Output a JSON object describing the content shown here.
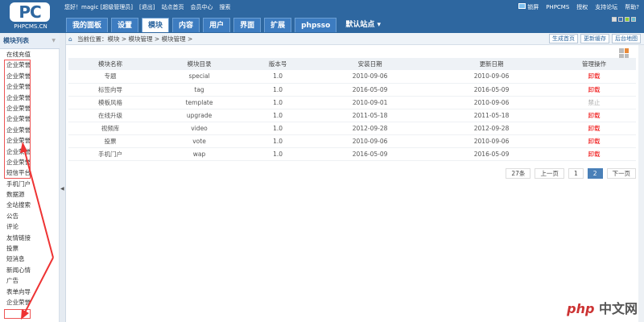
{
  "logo": {
    "mark": "PC",
    "sub": "PHPCMS.CN"
  },
  "userbar": [
    "您好！magic [超级管理员]",
    "[退出]",
    "站点首页",
    "会员中心",
    "搜索"
  ],
  "rightlinks": [
    "锁屏",
    "PHPCMS",
    "授权",
    "支持论坛",
    "帮助?"
  ],
  "tabs": [
    "我的面板",
    "设置",
    "模块",
    "内容",
    "用户",
    "界面",
    "扩展",
    "phpsso",
    "默认站点 ▾"
  ],
  "sidebar": {
    "title": "模块列表",
    "items": [
      "在线充值",
      "企业荣誉",
      "企业荣誉",
      "企业荣誉",
      "企业荣誉",
      "企业荣誉",
      "企业荣誉",
      "企业荣誉",
      "企业荣誉",
      "企业荣誉",
      "企业荣誉",
      "短信平台",
      "手机门户",
      "数据源",
      "全站搜索",
      "公告",
      "评论",
      "友情链接",
      "投票",
      "短消息",
      "新闻心情",
      "广告",
      "表单向导",
      "企业荣誉"
    ]
  },
  "breadcrumb": "当前位置：模块 > 模块管理 > 模块管理 >",
  "crumb_buttons": [
    "生成首页",
    "更新缓存",
    "后台地图"
  ],
  "table": {
    "headers": [
      "模块名称",
      "模块目录",
      "版本号",
      "安装日期",
      "更新日期",
      "管理操作"
    ],
    "rows": [
      [
        "专题",
        "special",
        "1.0",
        "2010-09-06",
        "2010-09-06",
        "卸载"
      ],
      [
        "标签向导",
        "tag",
        "1.0",
        "2016-05-09",
        "2016-05-09",
        "卸载"
      ],
      [
        "模板风格",
        "template",
        "1.0",
        "2010-09-01",
        "2010-09-06",
        "禁止"
      ],
      [
        "在线升级",
        "upgrade",
        "1.0",
        "2011-05-18",
        "2011-05-18",
        "卸载"
      ],
      [
        "视频库",
        "video",
        "1.0",
        "2012-09-28",
        "2012-09-28",
        "卸载"
      ],
      [
        "投票",
        "vote",
        "1.0",
        "2010-09-06",
        "2010-09-06",
        "卸载"
      ],
      [
        "手机门户",
        "wap",
        "1.0",
        "2016-05-09",
        "2016-05-09",
        "卸载"
      ]
    ]
  },
  "pager": {
    "total": "27条",
    "prev": "上一页",
    "pages": [
      "1",
      "2"
    ],
    "current": "2",
    "next": "下一页"
  },
  "watermark": {
    "a": "php",
    "b": "中文网"
  }
}
